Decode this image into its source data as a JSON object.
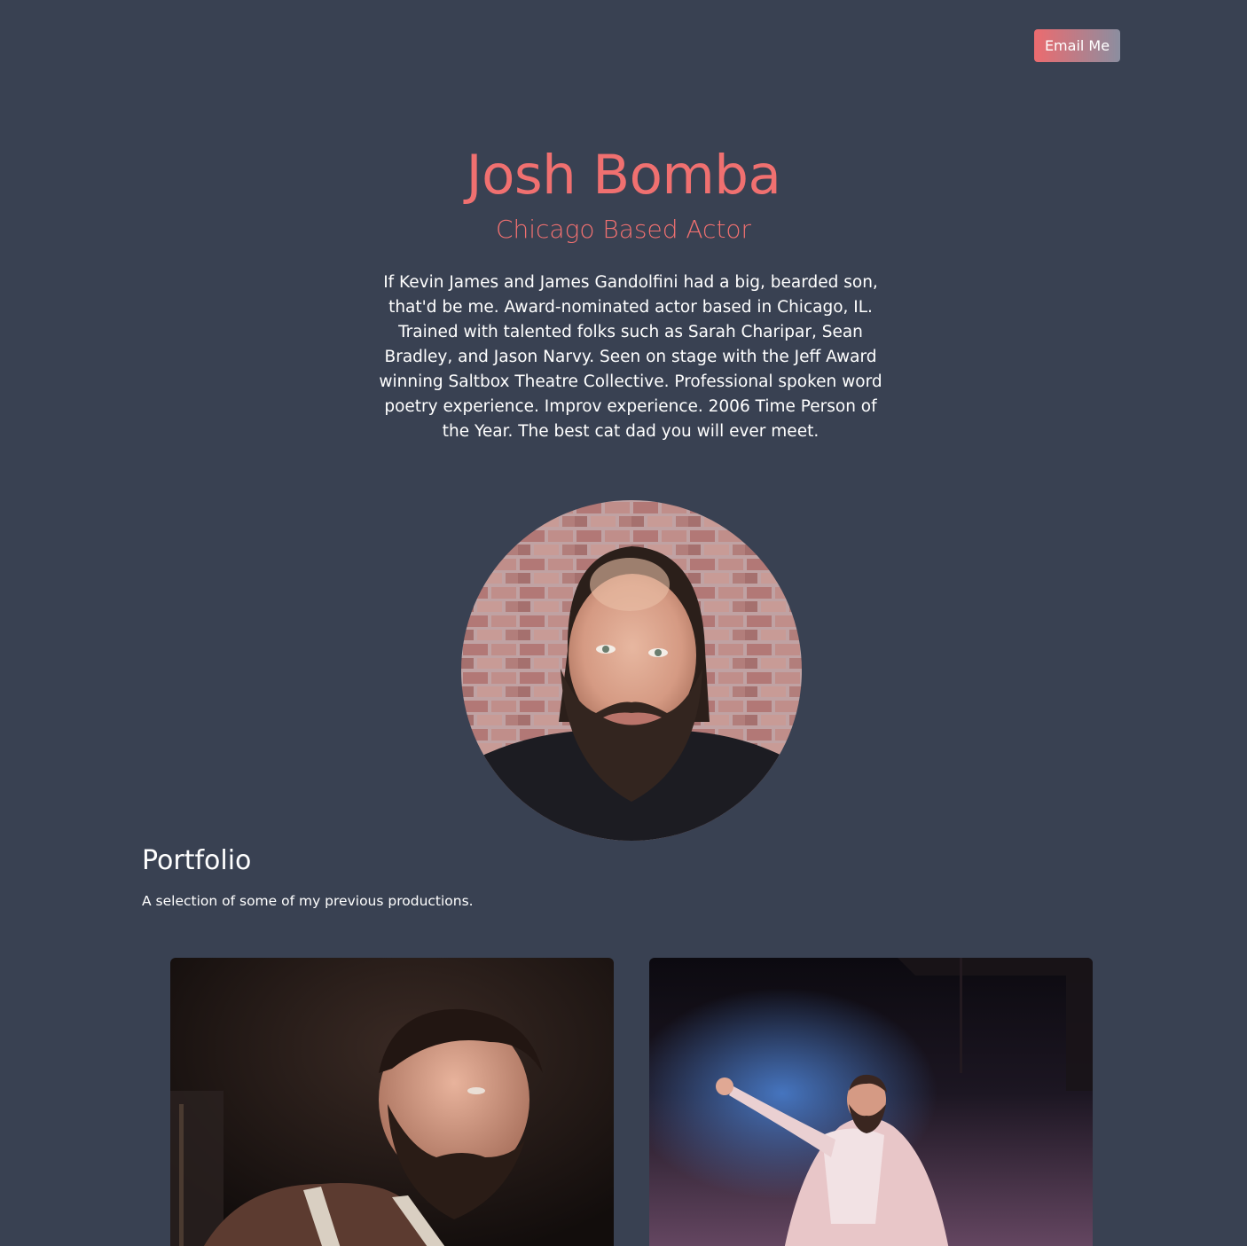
{
  "header": {
    "email_button_label": "Email Me"
  },
  "hero": {
    "name": "Josh Bomba",
    "tagline": "Chicago Based Actor",
    "bio": "If Kevin James and James Gandolfini had a big, bearded son, that'd be me. Award-nominated actor based in Chicago, IL. Trained with talented folks such as Sarah Charipar, Sean Bradley, and Jason Narvy. Seen on stage with the Jeff Award winning Saltbox Theatre Collective. Professional spoken word poetry experience. Improv experience. 2006 Time Person of the Year. The best cat dad you will ever meet."
  },
  "portfolio": {
    "title": "Portfolio",
    "description": "A selection of some of my previous productions."
  },
  "colors": {
    "background": "#394152",
    "accent": "#f07070",
    "button_gradient_start": "#ec6b6f",
    "button_gradient_end": "#8b8ea0"
  }
}
